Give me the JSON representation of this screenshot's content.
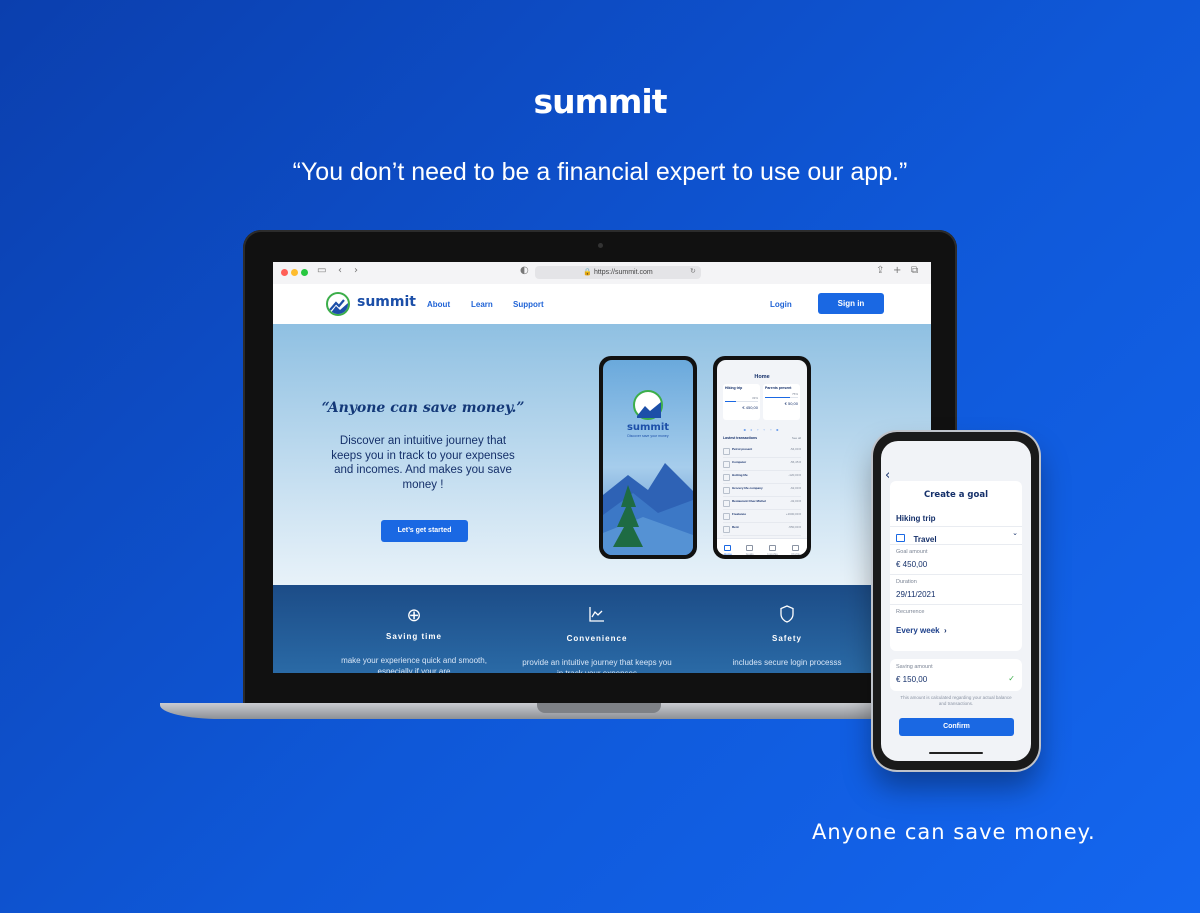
{
  "brand": "summit",
  "tagline": "“You don’t need to be a financial expert to use our app.”",
  "bottom_tagline": "Anyone can save money.",
  "browser": {
    "url": "https://summit.com"
  },
  "site": {
    "brand": "summit",
    "nav": [
      "About",
      "Learn",
      "Support"
    ],
    "login": "Login",
    "signin": "Sign in",
    "hero": {
      "title": "“Anyone can save money.”",
      "body": "Discover an intuitive journey that keeps you in track to your expenses and incomes. And makes you save money !",
      "cta": "Let’s get started"
    },
    "features": [
      {
        "title": "Saving time",
        "desc": "make your experience quick and smooth, especially if your are"
      },
      {
        "title": "Convenience",
        "desc": "provide an intuitive journey that keeps you in track your expenses"
      },
      {
        "title": "Safety",
        "desc": "includes secure login processs"
      }
    ]
  },
  "mini_phone_home": {
    "title": "Home",
    "goals": [
      {
        "name": "Hiking trip",
        "pct": "33%",
        "amount": "€ 450,00",
        "progress": 0.33
      },
      {
        "name": "Parents present",
        "pct": "75%",
        "amount": "€ 50,00",
        "progress": 0.75
      }
    ],
    "section": "Lastest transactions",
    "see_all": "See all",
    "transactions": [
      {
        "name": "Petrol present",
        "amount": "-54,00 €"
      },
      {
        "name": "Computer",
        "amount": "-56,45 €"
      },
      {
        "name": "Hotting life",
        "amount": "-120,00 €"
      },
      {
        "name": "Grocery life company",
        "amount": "-62,00 €"
      },
      {
        "name": "Restaurant Chez Michel",
        "amount": "-32,00 €"
      },
      {
        "name": "Freelance",
        "amount": "+1600,00 €"
      },
      {
        "name": "Rent",
        "amount": "-550,00 €"
      }
    ],
    "tabs": [
      "Home",
      "Goals",
      "Insights",
      "Profile"
    ]
  },
  "mini_phone_splash": {
    "brand": "summit",
    "subtitle": "Discover save your money"
  },
  "goal_form": {
    "title": "Create a goal",
    "goal_name": "Hiking trip",
    "category": "Travel",
    "goal_amount_label": "Goal amount",
    "goal_amount": "€ 450,00",
    "duration_label": "Duration",
    "duration": "29/11/2021",
    "recurrence_label": "Recurrence",
    "recurrence": "Every week",
    "saving_label": "Saving amount",
    "saving": "€ 150,00",
    "note": "This amount is calculated regarding your actual balance and transactions.",
    "confirm": "Confirm"
  },
  "colors": {
    "background": "#0f58d8",
    "accent": "#1a68e3",
    "brand_green": "#3cae4a",
    "navy": "#15306a"
  }
}
